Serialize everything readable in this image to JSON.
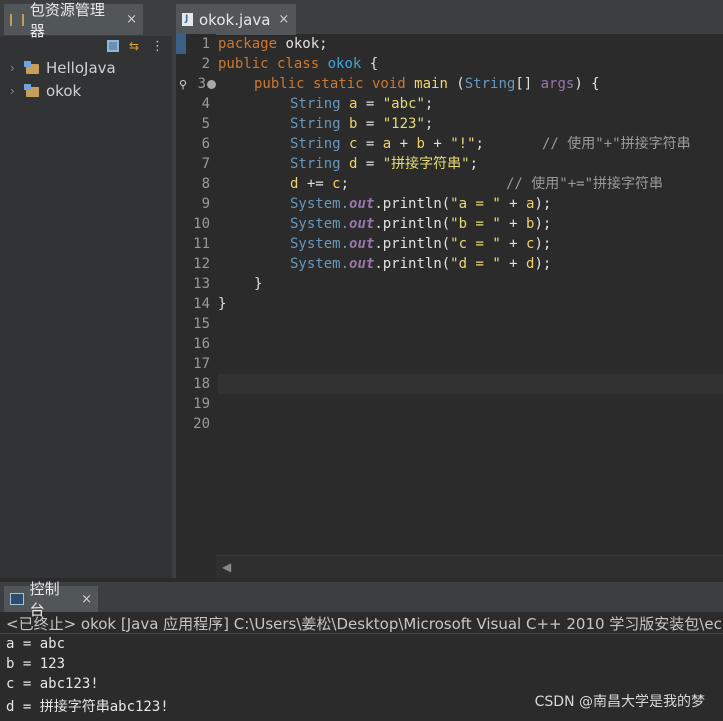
{
  "package_explorer": {
    "tab_label": "包资源管理器",
    "close": "×",
    "tree": [
      {
        "label": "HelloJava"
      },
      {
        "label": "okok"
      }
    ]
  },
  "editor": {
    "tab_label": "okok.java",
    "close": "×",
    "line_numbers": [
      "1",
      "2",
      "3",
      "4",
      "5",
      "6",
      "7",
      "8",
      "9",
      "10",
      "11",
      "12",
      "13",
      "14",
      "15",
      "16",
      "17",
      "18",
      "19",
      "20"
    ],
    "code": {
      "l1_kw": "package",
      "l1_rest": " okok;",
      "l2_kw": "public class",
      "l2_cls": "okok",
      "l2_rest": " {",
      "l3_kw": "public static void",
      "l3_m": "main",
      "l3_paren": " (",
      "l3_type": "String",
      "l3_br": "[] ",
      "l3_var": "args",
      "l3_end": ") {",
      "l4_type": "String",
      "l4_var": "a",
      "l4_eq": " = ",
      "l4_str": "\"abc\"",
      "l4_end": ";",
      "l5_type": "String",
      "l5_var": "b",
      "l5_eq": " = ",
      "l5_str": "\"123\"",
      "l5_end": ";",
      "l6_type": "String",
      "l6_var": "c",
      "l6_eq": " = ",
      "l6_a": "a",
      "l6_p1": " + ",
      "l6_b": "b",
      "l6_p2": " + ",
      "l6_str": "\"!\"",
      "l6_end": ";",
      "l6_cmt": "// 使用\"+\"拼接字符串",
      "l7_type": "String",
      "l7_var": "d",
      "l7_eq": " = ",
      "l7_str": "\"拼接字符串\"",
      "l7_end": ";",
      "l8_d": "d",
      "l8_op": " += ",
      "l8_c": "c",
      "l8_end": ";",
      "l8_cmt": "// 使用\"+=\"拼接字符串",
      "println_sys": "System.",
      "println_out": "out",
      "println_m": ".println(",
      "l9_str": "\"a = \"",
      "l9_plus": " + ",
      "l9_v": "a",
      "l9_end": ");",
      "l10_str": "\"b = \"",
      "l10_plus": " + ",
      "l10_v": "b",
      "l10_end": ");",
      "l11_str": "\"c = \"",
      "l11_plus": " + ",
      "l11_v": "c",
      "l11_end": ");",
      "l12_str": "\"d = \"",
      "l12_plus": " + ",
      "l12_v": "d",
      "l12_end": ");",
      "l13": "}",
      "l14": "}"
    }
  },
  "console": {
    "tab_label": "控制台",
    "close": "×",
    "status": "<已终止> okok [Java 应用程序] C:\\Users\\姜松\\Desktop\\Microsoft Visual C++ 2010 学习版安装包\\eclips",
    "output": [
      "a = abc",
      "b = 123",
      "c = abc123!",
      "d = 拼接字符串abc123!"
    ]
  },
  "watermark": "CSDN @南昌大学是我的梦"
}
